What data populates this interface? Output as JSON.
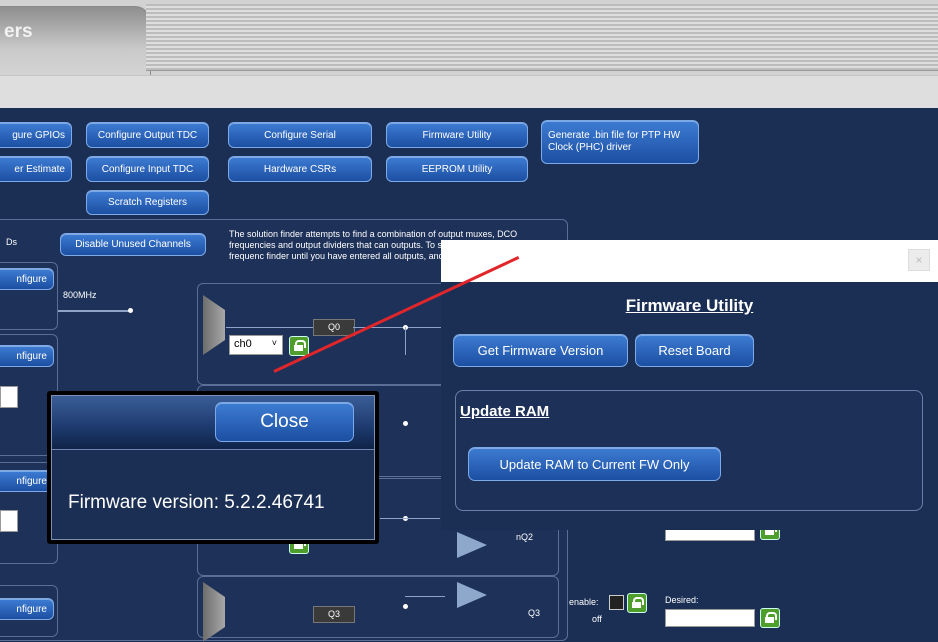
{
  "app": {
    "tab_label": "ers"
  },
  "toolbar": {
    "row1": {
      "configure_gpios": "gure GPIOs",
      "configure_output_tdc": "Configure Output TDC",
      "configure_serial": "Configure Serial",
      "firmware_utility": "Firmware Utility",
      "generate_bin": "Generate .bin file for PTP HW Clock (PHC) driver"
    },
    "row2": {
      "power_estimate": "er Estimate",
      "configure_input_tdc": "Configure Input TDC",
      "hardware_csrs": "Hardware CSRs",
      "eeprom_utility": "EEPROM Utility"
    },
    "row3": {
      "scratch_registers": "Scratch Registers"
    }
  },
  "solution_panel": {
    "left_fragment": "Ds",
    "disable_unused_channels": "Disable Unused Channels",
    "note": "The solution finder attempts to find a combination of output muxes, DCO frequencies and output dividers that can outputs. To speed up entry of output frequenc finder until you have entered all outputs, and t",
    "freq_label": "800MHz",
    "channel_select": "ch0",
    "outputs": [
      "Q0",
      "nQ2",
      "Q3"
    ],
    "enable_label": "enable:",
    "off_label": "off",
    "desired_label": "Desired:",
    "configure_buttons": [
      "nfigure",
      "nfigure",
      "nfigure",
      "nfigure"
    ]
  },
  "firmware_dialog": {
    "title": "Firmware Utility",
    "close_x": "×",
    "get_version_button": "Get Firmware Version",
    "reset_board_button": "Reset Board",
    "update_ram_heading": "Update RAM",
    "update_ram_button": "Update RAM to Current FW Only"
  },
  "version_popup": {
    "close_button": "Close",
    "message": "Firmware version: 5.2.2.46741"
  },
  "colors": {
    "background": "#1b2f55",
    "button": "#2a64bd",
    "annotation": "#e0262b",
    "lock": "#4f9e2c"
  }
}
